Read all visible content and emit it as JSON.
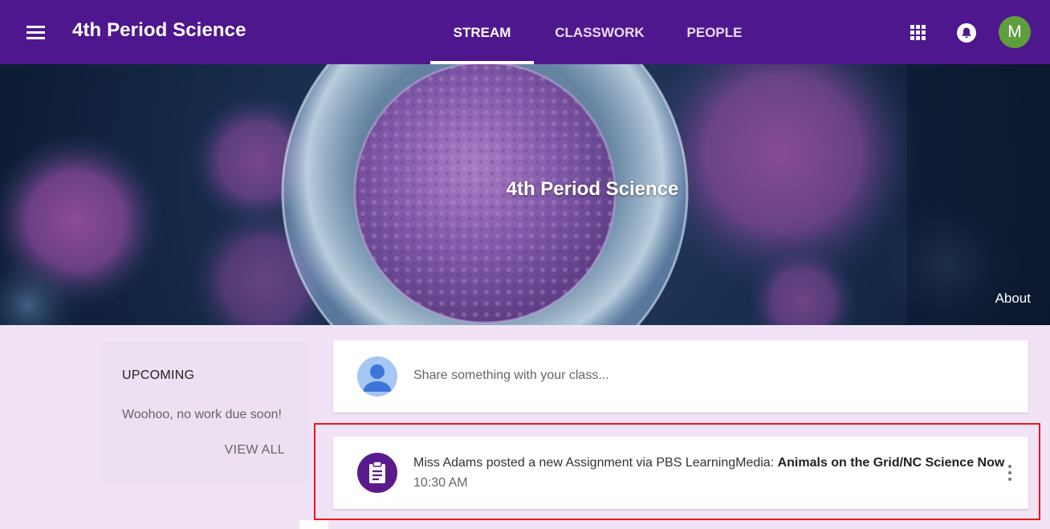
{
  "header": {
    "title": "4th Period Science",
    "tabs": [
      {
        "label": "STREAM",
        "active": true
      },
      {
        "label": "CLASSWORK",
        "active": false
      },
      {
        "label": "PEOPLE",
        "active": false
      }
    ],
    "user_initial": "M",
    "icons": {
      "menu": "menu-icon",
      "apps": "apps-grid-icon",
      "notifications": "bell-icon"
    },
    "colors": {
      "bar": "#4e178e",
      "avatar": "#5f9e3c"
    }
  },
  "banner": {
    "title": "4th Period Science",
    "about_label": "About"
  },
  "upcoming": {
    "title": "UPCOMING",
    "empty_message": "Woohoo, no work due soon!",
    "view_all_label": "VIEW ALL"
  },
  "share": {
    "placeholder": "Share something with your class..."
  },
  "stream": {
    "posts": [
      {
        "author": "Miss Adams",
        "action": "posted a new Assignment via PBS LearningMedia:",
        "title": "Animals on the Grid/NC Science Now",
        "time": "10:30 AM",
        "icon": "assignment-icon"
      }
    ]
  }
}
